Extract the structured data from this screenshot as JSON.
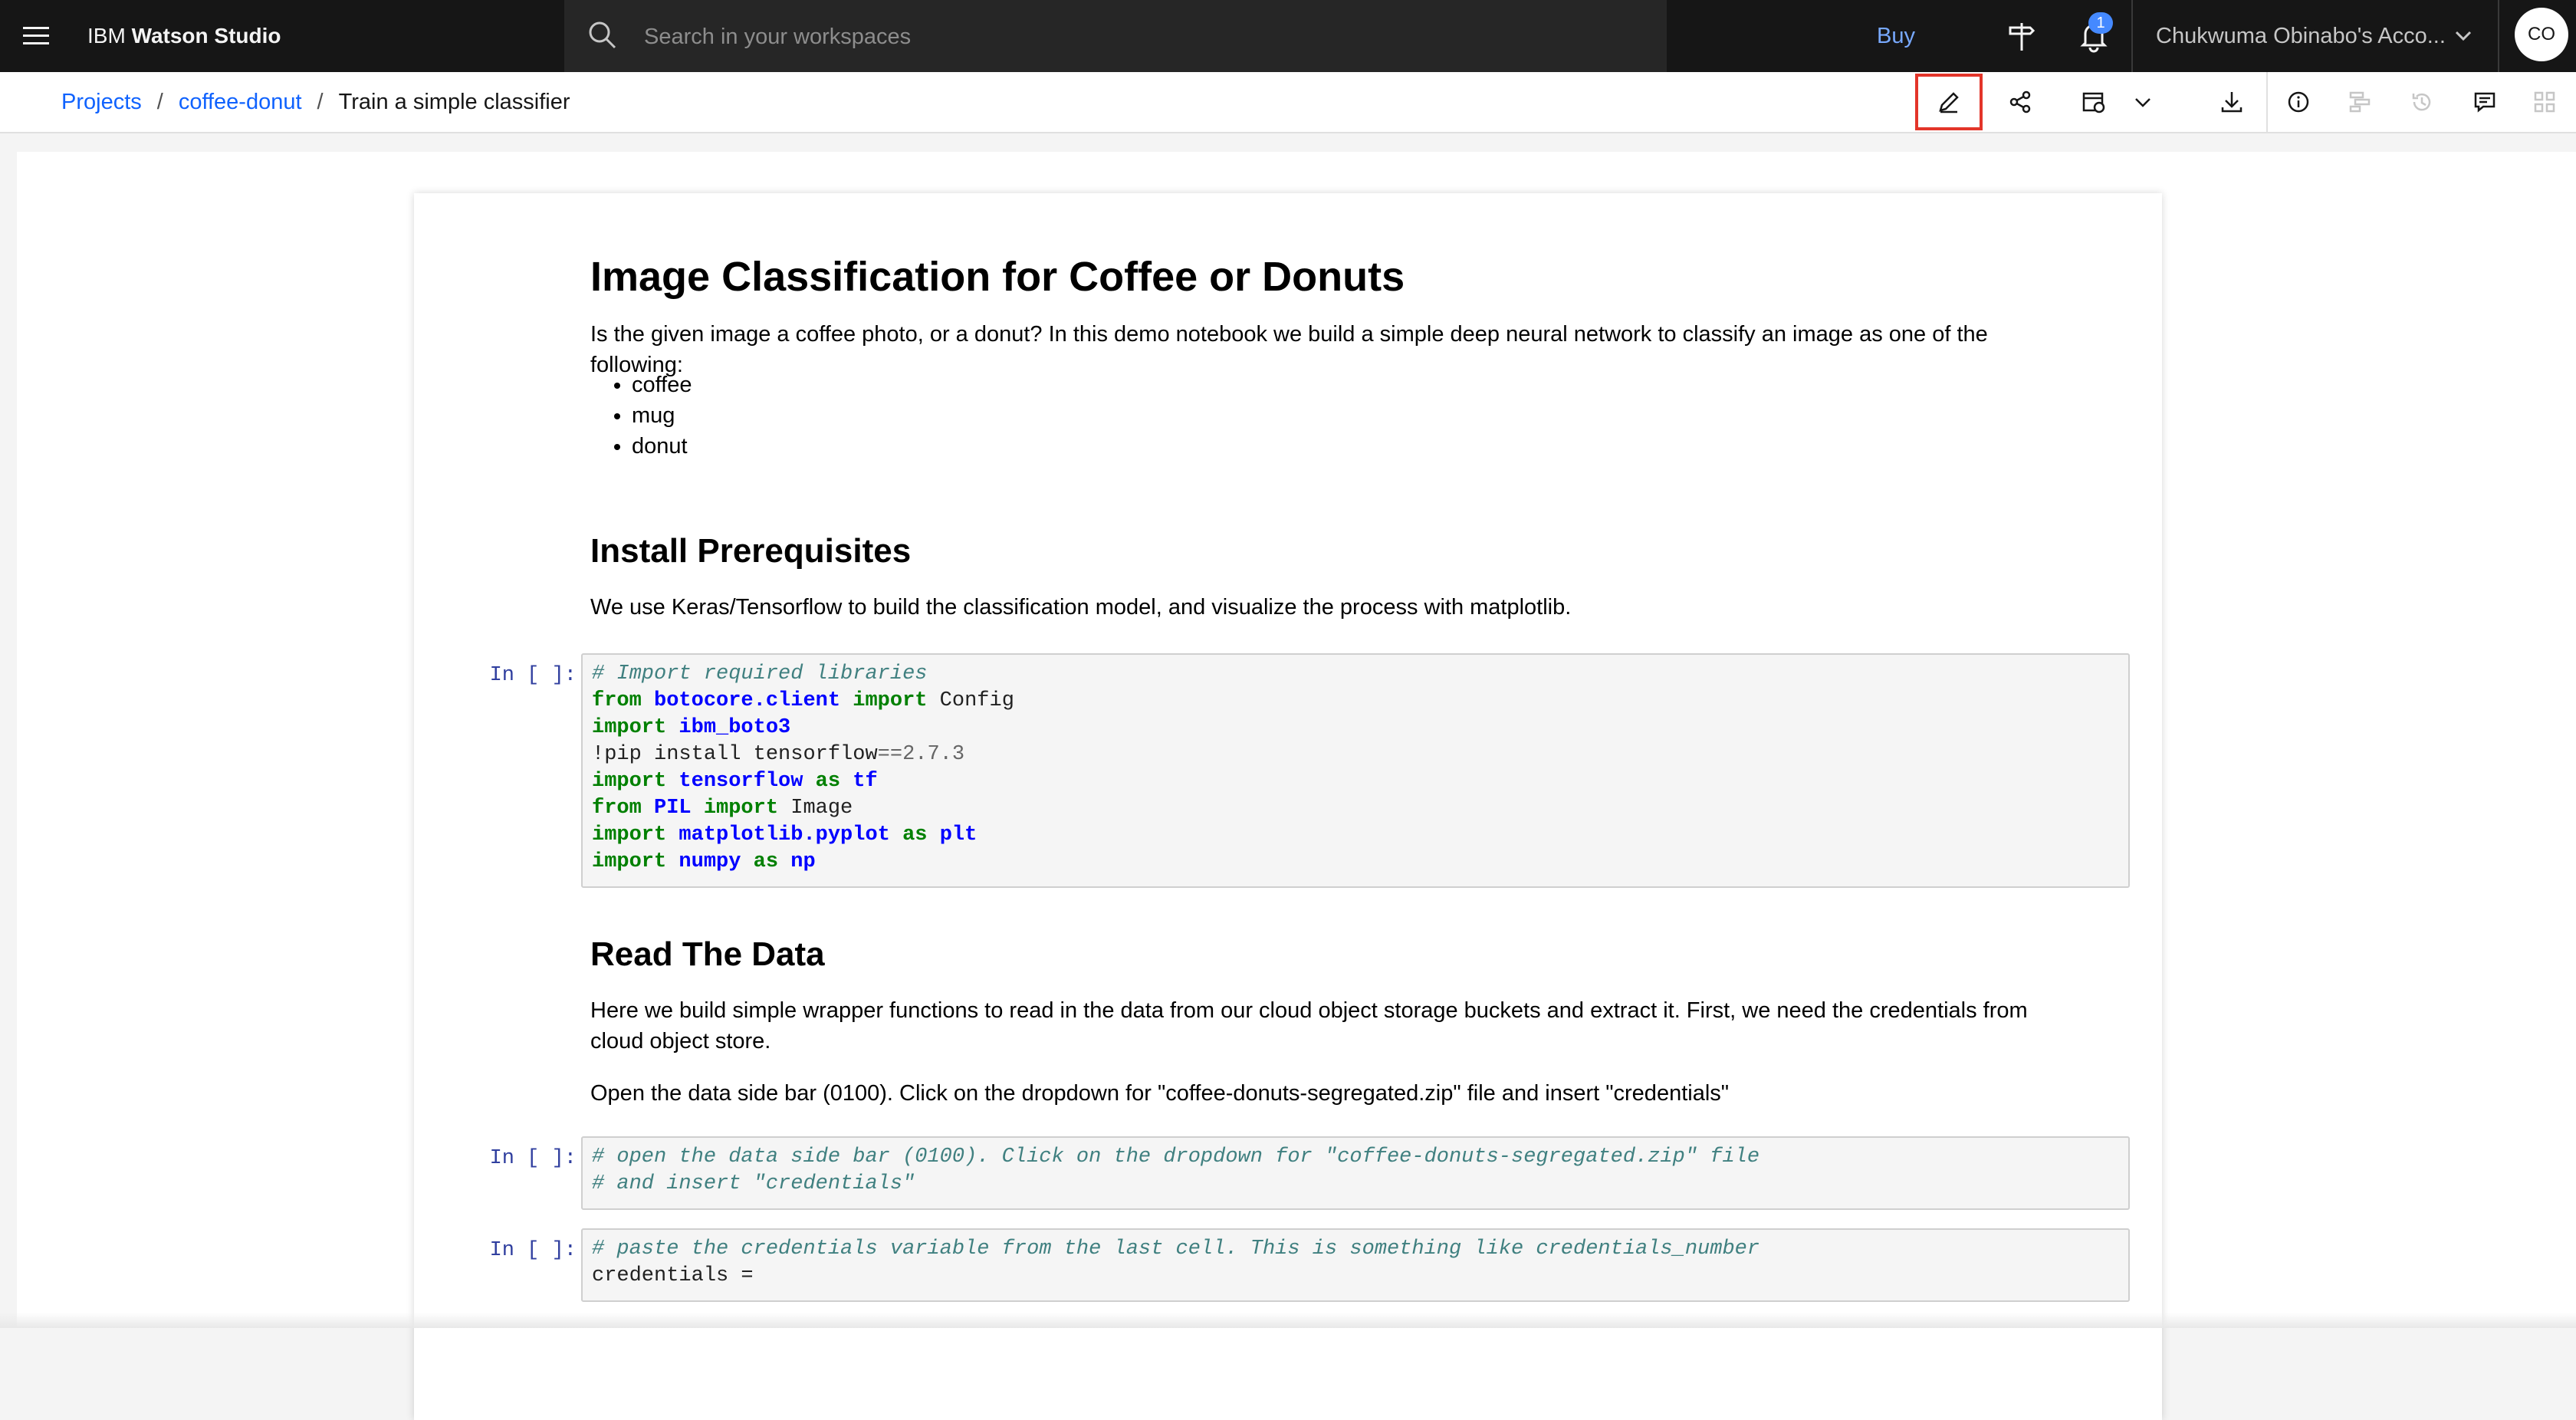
{
  "header": {
    "brand_prefix": "IBM",
    "brand_name": "Watson Studio",
    "search_placeholder": "Search in your workspaces",
    "buy_label": "Buy",
    "notification_count": "1",
    "account_name": "Chukwuma Obinabo's Acco...",
    "avatar_initials": "CO"
  },
  "breadcrumb": {
    "items": [
      "Projects",
      "coffee-donut"
    ],
    "current": "Train a simple classifier",
    "separator": "/"
  },
  "toolbar": {
    "buttons": [
      "edit-icon",
      "share-icon",
      "schedule-job-icon",
      "chevron-down-icon",
      "download-icon",
      "info-icon",
      "data-icon",
      "version-history-icon",
      "comments-icon",
      "code-snippets-icon"
    ],
    "highlight_color": "#e3352a"
  },
  "notebook": {
    "title": "Image Classification for Coffee or Donuts",
    "intro": "Is the given image a coffee photo, or a donut? In this demo notebook we build a simple deep neural network to classify an image as one of the following:",
    "classes": [
      "coffee",
      "mug",
      "donut"
    ],
    "section1_title": "Install Prerequisites",
    "section1_text": "We use Keras/Tensorflow to build the classification model, and visualize the process with matplotlib.",
    "prompt": "In [ ]:",
    "cell1": [
      "# Import required libraries",
      "from botocore.client import Config",
      "import ibm_boto3",
      "!pip install tensorflow==2.7.3",
      "import tensorflow as tf",
      "from PIL import Image",
      "import matplotlib.pyplot as plt",
      "import numpy as np"
    ],
    "section2_title": "Read The Data",
    "section2_text": "Here we build simple wrapper functions to read in the data from our cloud object storage buckets and extract it. First, we need the credentials from cloud object store.",
    "section2_text2": "Open the data side bar (0100). Click on the dropdown for \"coffee-donuts-segregated.zip\" file and insert \"credentials\"",
    "cell2": [
      "# open the data side bar (0100). Click on the dropdown for \"coffee-donuts-segregated.zip\" file",
      "# and insert \"credentials\""
    ],
    "cell3": [
      "# paste the credentials variable from the last cell. This is something like credentials_number",
      "credentials ="
    ]
  }
}
